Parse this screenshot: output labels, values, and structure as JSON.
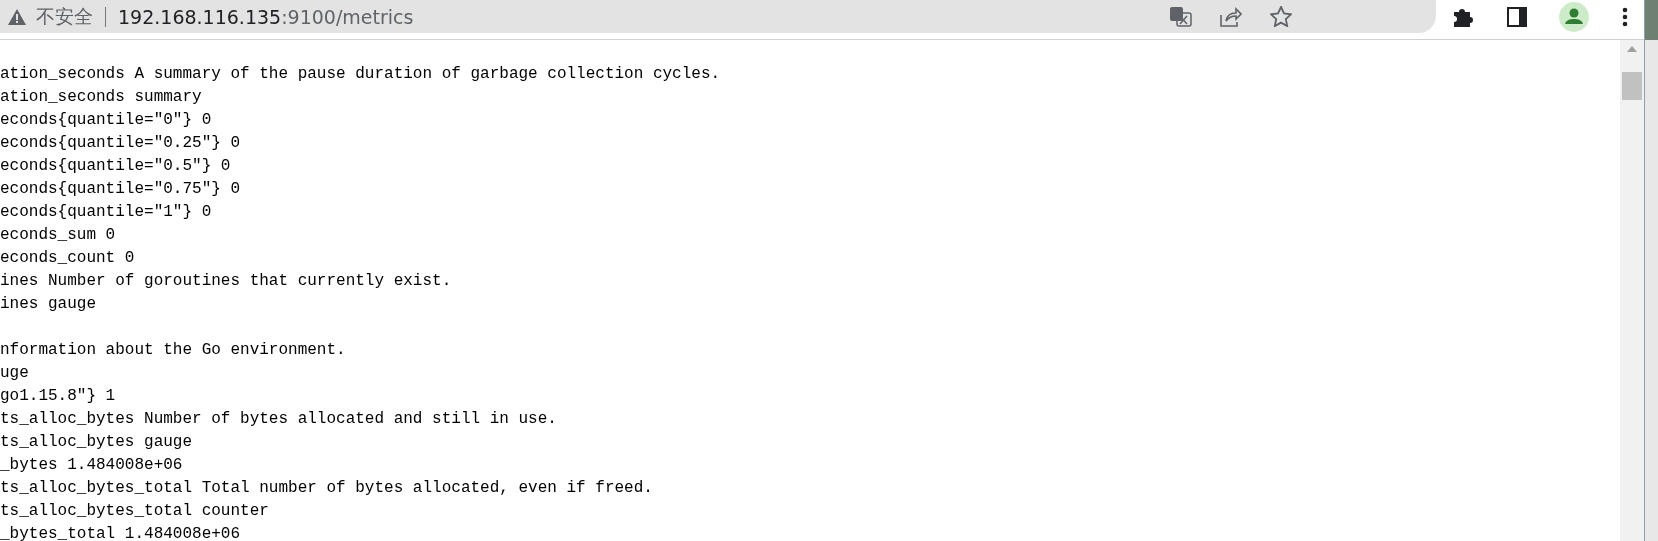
{
  "address_bar": {
    "security_label": "不安全",
    "host": "192.168.116.135",
    "port_path": ":9100/metrics"
  },
  "lines": [
    {
      "kind": "text",
      "text": "ation_seconds A summary of the pause duration of garbage collection cycles."
    },
    {
      "kind": "text",
      "text": "ation_seconds summary"
    },
    {
      "kind": "text",
      "text": "econds{quantile=\"0\"} 0"
    },
    {
      "kind": "text",
      "text": "econds{quantile=\"0.25\"} 0"
    },
    {
      "kind": "text",
      "text": "econds{quantile=\"0.5\"} 0"
    },
    {
      "kind": "text",
      "text": "econds{quantile=\"0.75\"} 0"
    },
    {
      "kind": "text",
      "text": "econds{quantile=\"1\"} 0"
    },
    {
      "kind": "text",
      "text": "econds_sum 0"
    },
    {
      "kind": "text",
      "text": "econds_count 0"
    },
    {
      "kind": "text",
      "text": "ines Number of goroutines that currently exist."
    },
    {
      "kind": "text",
      "text": "ines gauge"
    },
    {
      "kind": "blank"
    },
    {
      "kind": "text",
      "text": "nformation about the Go environment."
    },
    {
      "kind": "text",
      "text": "uge"
    },
    {
      "kind": "text",
      "text": "go1.15.8\"} 1"
    },
    {
      "kind": "text",
      "text": "ts_alloc_bytes Number of bytes allocated and still in use."
    },
    {
      "kind": "text",
      "text": "ts_alloc_bytes gauge"
    },
    {
      "kind": "text",
      "text": "_bytes 1.484008e+06"
    },
    {
      "kind": "text",
      "text": "ts_alloc_bytes_total Total number of bytes allocated, even if freed."
    },
    {
      "kind": "text",
      "text": "ts_alloc_bytes_total counter"
    },
    {
      "kind": "text",
      "text": "_bytes_total 1.484008e+06"
    }
  ]
}
